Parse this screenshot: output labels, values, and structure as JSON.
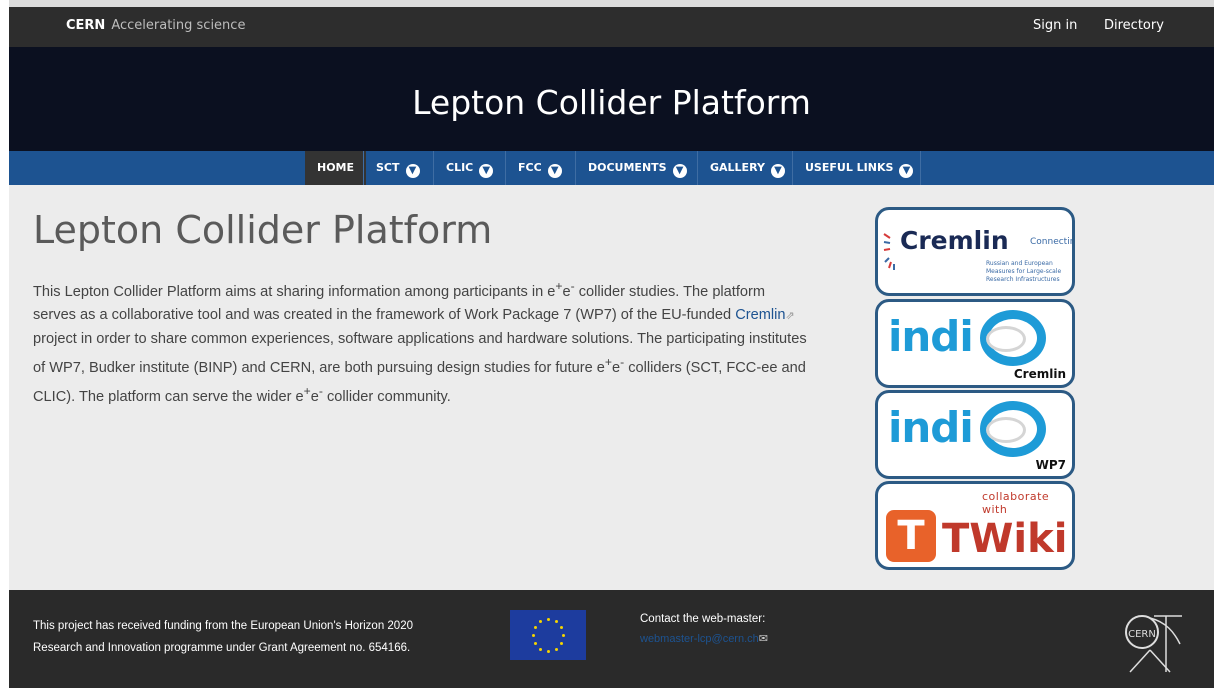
{
  "topbar": {
    "brand_bold": "CERN",
    "brand_text": "Accelerating science",
    "sign_in": "Sign in",
    "directory": "Directory"
  },
  "banner": {
    "title": "Lepton Collider Platform"
  },
  "nav": {
    "items": [
      {
        "label": "HOME",
        "active": true
      },
      {
        "label": "SCT"
      },
      {
        "label": "CLIC"
      },
      {
        "label": "FCC"
      },
      {
        "label": "DOCUMENTS"
      },
      {
        "label": "GALLERY"
      },
      {
        "label": "USEFUL LINKS"
      }
    ],
    "arrow_icon": "arrow-down-circle-icon"
  },
  "main": {
    "heading": "Lepton Collider Platform",
    "intro": {
      "p1": "This Lepton Collider Platform aims at sharing information among participants in e",
      "sup1": "+",
      "mid1": "e",
      "sup2": "-",
      "p2": " collider studies. The platform serves as a collaborative tool and was created in the framework of Work Package 7 (WP7) of the EU-funded ",
      "link": "Cremlin",
      "p3": " project in order to share common experiences, software applications and hardware solutions. The participating institutes of WP7, Budker institute (BINP) and CERN, are both pursuing design studies for future e",
      "sup3": "+",
      "mid2": "e",
      "sup4": "-",
      "p4": " colliders (SCT, FCC-ee and CLIC). The platform can serve the wider e",
      "sup5": "+",
      "mid3": "e",
      "sup6": "-",
      "p5": " collider community."
    }
  },
  "sidebar": {
    "cremlin": {
      "word": "Cremlin",
      "connecting": "Connecting",
      "sub": "Russian and European Measures for Large-scale Research Infrastructures"
    },
    "indico_cremlin": {
      "word": "indi",
      "caption": "Cremlin"
    },
    "indico_wp7": {
      "word": "indi",
      "caption": "WP7"
    },
    "twiki": {
      "collab": "collaborate with",
      "t": "T",
      "word": "TWiki"
    }
  },
  "footer": {
    "funding_line1": "This project has received funding from the European Union's Horizon 2020",
    "funding_line2": "Research and Innovation programme under Grant Agreement no. 654166.",
    "contact_label": "Contact the web-master:",
    "contact_email": "webmaster-lcp@cern.ch",
    "cern_logo": "CERN"
  },
  "colors": {
    "nav_blue": "#1d5391",
    "banner": "#0b1020",
    "footer": "#2a2a2a"
  }
}
